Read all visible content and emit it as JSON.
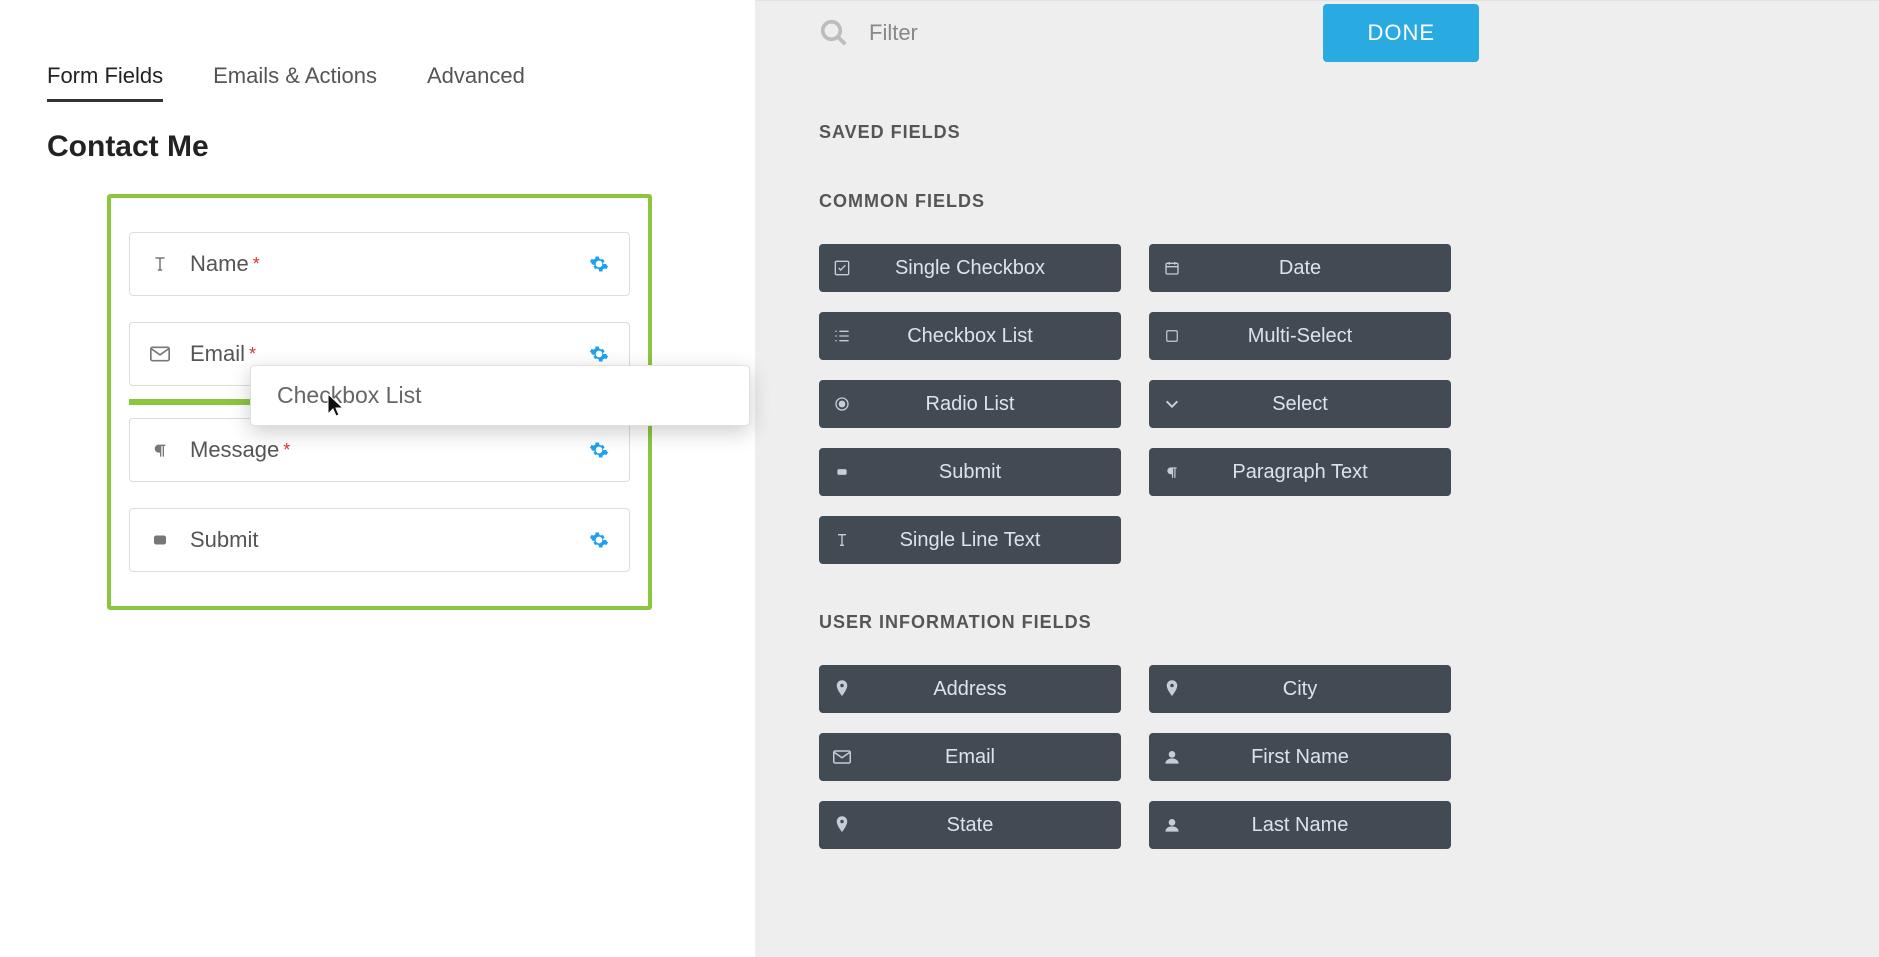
{
  "tabs": {
    "form_fields": "Form Fields",
    "emails_actions": "Emails & Actions",
    "advanced": "Advanced"
  },
  "form": {
    "title": "Contact Me",
    "fields": [
      {
        "label": "Name",
        "required": true,
        "icon": "text"
      },
      {
        "label": "Email",
        "required": true,
        "icon": "mail"
      },
      {
        "label": "Message",
        "required": true,
        "icon": "paragraph"
      },
      {
        "label": "Submit",
        "required": false,
        "icon": "button"
      }
    ]
  },
  "drag_ghost_label": "Checkbox List",
  "search_placeholder": "Filter",
  "done_label": "DONE",
  "sections": {
    "saved": "SAVED FIELDS",
    "common": "COMMON FIELDS",
    "user": "USER INFORMATION FIELDS"
  },
  "common_fields": {
    "single_checkbox": "Single Checkbox",
    "date": "Date",
    "checkbox_list": "Checkbox List",
    "multi_select": "Multi-Select",
    "radio_list": "Radio List",
    "select": "Select",
    "submit": "Submit",
    "paragraph_text": "Paragraph Text",
    "single_line_text": "Single Line Text"
  },
  "user_fields": {
    "address": "Address",
    "city": "City",
    "email": "Email",
    "first_name": "First Name",
    "state": "State",
    "last_name": "Last Name"
  }
}
